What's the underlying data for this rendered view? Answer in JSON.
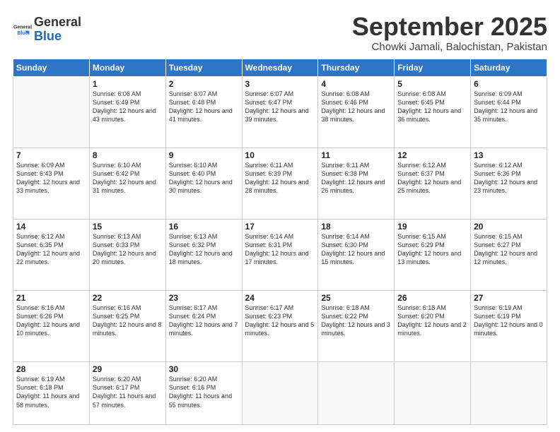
{
  "logo": {
    "line1": "General",
    "line2": "Blue"
  },
  "title": "September 2025",
  "subtitle": "Chowki Jamali, Balochistan, Pakistan",
  "days_of_week": [
    "Sunday",
    "Monday",
    "Tuesday",
    "Wednesday",
    "Thursday",
    "Friday",
    "Saturday"
  ],
  "weeks": [
    [
      {
        "num": "",
        "sunrise": "",
        "sunset": "",
        "daylight": ""
      },
      {
        "num": "1",
        "sunrise": "6:06 AM",
        "sunset": "6:49 PM",
        "daylight": "12 hours and 43 minutes."
      },
      {
        "num": "2",
        "sunrise": "6:07 AM",
        "sunset": "6:48 PM",
        "daylight": "12 hours and 41 minutes."
      },
      {
        "num": "3",
        "sunrise": "6:07 AM",
        "sunset": "6:47 PM",
        "daylight": "12 hours and 39 minutes."
      },
      {
        "num": "4",
        "sunrise": "6:08 AM",
        "sunset": "6:46 PM",
        "daylight": "12 hours and 38 minutes."
      },
      {
        "num": "5",
        "sunrise": "6:08 AM",
        "sunset": "6:45 PM",
        "daylight": "12 hours and 36 minutes."
      },
      {
        "num": "6",
        "sunrise": "6:09 AM",
        "sunset": "6:44 PM",
        "daylight": "12 hours and 35 minutes."
      }
    ],
    [
      {
        "num": "7",
        "sunrise": "6:09 AM",
        "sunset": "6:43 PM",
        "daylight": "12 hours and 33 minutes."
      },
      {
        "num": "8",
        "sunrise": "6:10 AM",
        "sunset": "6:42 PM",
        "daylight": "12 hours and 31 minutes."
      },
      {
        "num": "9",
        "sunrise": "6:10 AM",
        "sunset": "6:40 PM",
        "daylight": "12 hours and 30 minutes."
      },
      {
        "num": "10",
        "sunrise": "6:11 AM",
        "sunset": "6:39 PM",
        "daylight": "12 hours and 28 minutes."
      },
      {
        "num": "11",
        "sunrise": "6:11 AM",
        "sunset": "6:38 PM",
        "daylight": "12 hours and 26 minutes."
      },
      {
        "num": "12",
        "sunrise": "6:12 AM",
        "sunset": "6:37 PM",
        "daylight": "12 hours and 25 minutes."
      },
      {
        "num": "13",
        "sunrise": "6:12 AM",
        "sunset": "6:36 PM",
        "daylight": "12 hours and 23 minutes."
      }
    ],
    [
      {
        "num": "14",
        "sunrise": "6:12 AM",
        "sunset": "6:35 PM",
        "daylight": "12 hours and 22 minutes."
      },
      {
        "num": "15",
        "sunrise": "6:13 AM",
        "sunset": "6:33 PM",
        "daylight": "12 hours and 20 minutes."
      },
      {
        "num": "16",
        "sunrise": "6:13 AM",
        "sunset": "6:32 PM",
        "daylight": "12 hours and 18 minutes."
      },
      {
        "num": "17",
        "sunrise": "6:14 AM",
        "sunset": "6:31 PM",
        "daylight": "12 hours and 17 minutes."
      },
      {
        "num": "18",
        "sunrise": "6:14 AM",
        "sunset": "6:30 PM",
        "daylight": "12 hours and 15 minutes."
      },
      {
        "num": "19",
        "sunrise": "6:15 AM",
        "sunset": "6:29 PM",
        "daylight": "12 hours and 13 minutes."
      },
      {
        "num": "20",
        "sunrise": "6:15 AM",
        "sunset": "6:27 PM",
        "daylight": "12 hours and 12 minutes."
      }
    ],
    [
      {
        "num": "21",
        "sunrise": "6:16 AM",
        "sunset": "6:26 PM",
        "daylight": "12 hours and 10 minutes."
      },
      {
        "num": "22",
        "sunrise": "6:16 AM",
        "sunset": "6:25 PM",
        "daylight": "12 hours and 8 minutes."
      },
      {
        "num": "23",
        "sunrise": "6:17 AM",
        "sunset": "6:24 PM",
        "daylight": "12 hours and 7 minutes."
      },
      {
        "num": "24",
        "sunrise": "6:17 AM",
        "sunset": "6:23 PM",
        "daylight": "12 hours and 5 minutes."
      },
      {
        "num": "25",
        "sunrise": "6:18 AM",
        "sunset": "6:22 PM",
        "daylight": "12 hours and 3 minutes."
      },
      {
        "num": "26",
        "sunrise": "6:18 AM",
        "sunset": "6:20 PM",
        "daylight": "12 hours and 2 minutes."
      },
      {
        "num": "27",
        "sunrise": "6:19 AM",
        "sunset": "6:19 PM",
        "daylight": "12 hours and 0 minutes."
      }
    ],
    [
      {
        "num": "28",
        "sunrise": "6:19 AM",
        "sunset": "6:18 PM",
        "daylight": "11 hours and 58 minutes."
      },
      {
        "num": "29",
        "sunrise": "6:20 AM",
        "sunset": "6:17 PM",
        "daylight": "11 hours and 57 minutes."
      },
      {
        "num": "30",
        "sunrise": "6:20 AM",
        "sunset": "6:16 PM",
        "daylight": "11 hours and 55 minutes."
      },
      {
        "num": "",
        "sunrise": "",
        "sunset": "",
        "daylight": ""
      },
      {
        "num": "",
        "sunrise": "",
        "sunset": "",
        "daylight": ""
      },
      {
        "num": "",
        "sunrise": "",
        "sunset": "",
        "daylight": ""
      },
      {
        "num": "",
        "sunrise": "",
        "sunset": "",
        "daylight": ""
      }
    ]
  ]
}
